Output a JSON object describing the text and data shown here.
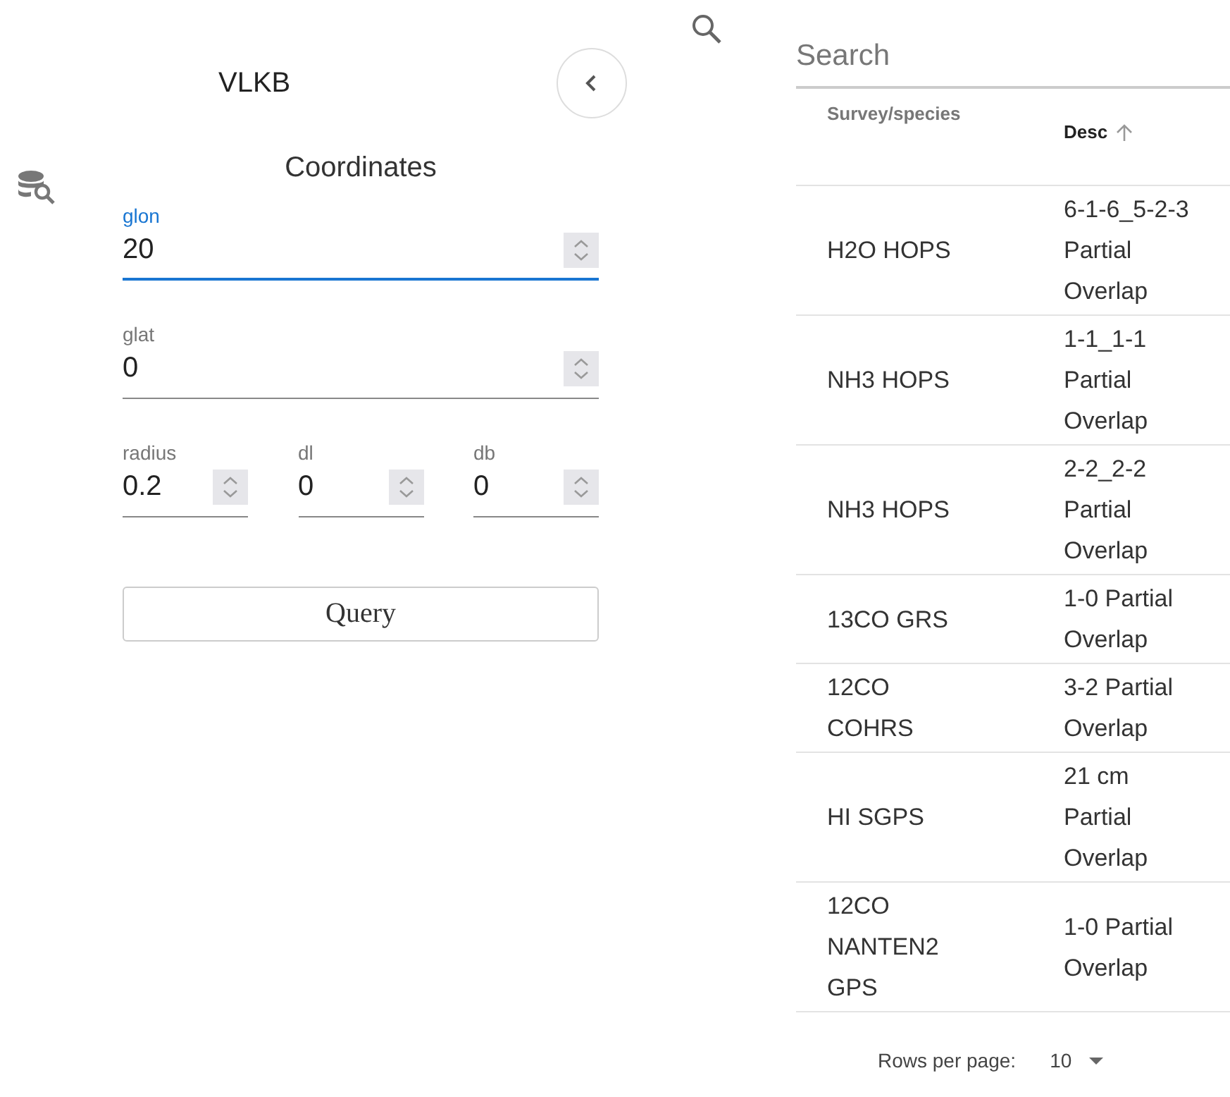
{
  "app": {
    "title": "VLKB"
  },
  "query_panel": {
    "heading": "Coordinates",
    "fields": [
      {
        "label": "glon",
        "value": "20",
        "focused": true
      },
      {
        "label": "glat",
        "value": "0",
        "focused": false
      }
    ],
    "small_fields": [
      {
        "label": "radius",
        "value": "0.2",
        "focused": false
      },
      {
        "label": "dl",
        "value": "0",
        "focused": false
      },
      {
        "label": "db",
        "value": "0",
        "focused": false
      }
    ],
    "button": "Query"
  },
  "results": {
    "search": {
      "placeholder": "Search"
    },
    "columns": [
      {
        "label": "Survey/species",
        "sorted": false
      },
      {
        "label": "Desc",
        "sorted": true
      }
    ],
    "rows": [
      [
        "H2O HOPS",
        "6-1-6_5-2-3 Partial Overlap"
      ],
      [
        "NH3 HOPS",
        "1-1_1-1 Partial Overlap"
      ],
      [
        "NH3 HOPS",
        "2-2_2-2 Partial Overlap"
      ],
      [
        "13CO GRS",
        "1-0 Partial Overlap"
      ],
      [
        "12CO COHRS",
        "3-2 Partial Overlap"
      ],
      [
        "HI SGPS",
        "21 cm Partial Overlap"
      ],
      [
        "12CO NANTEN2 GPS",
        "1-0 Partial Overlap"
      ]
    ],
    "pagination": {
      "label": "Rows per page:",
      "value": "10"
    }
  }
}
